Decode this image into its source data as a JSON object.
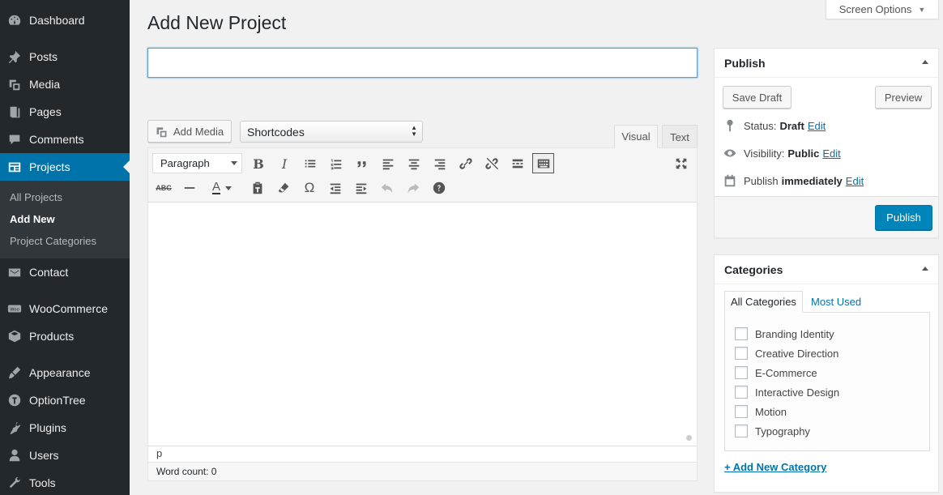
{
  "sidebar": {
    "items": [
      {
        "label": "Dashboard",
        "icon": "dashboard-icon"
      },
      {
        "label": "Posts",
        "icon": "pin-icon"
      },
      {
        "label": "Media",
        "icon": "media-icon"
      },
      {
        "label": "Pages",
        "icon": "page-icon"
      },
      {
        "label": "Comments",
        "icon": "comment-icon"
      },
      {
        "label": "Projects",
        "icon": "portfolio-icon",
        "active": true
      },
      {
        "label": "Contact",
        "icon": "mail-icon"
      },
      {
        "label": "WooCommerce",
        "icon": "woocommerce-icon"
      },
      {
        "label": "Products",
        "icon": "archive-icon"
      },
      {
        "label": "Appearance",
        "icon": "brush-icon"
      },
      {
        "label": "OptionTree",
        "icon": "optiontree-icon"
      },
      {
        "label": "Plugins",
        "icon": "plugin-icon"
      },
      {
        "label": "Users",
        "icon": "user-icon"
      },
      {
        "label": "Tools",
        "icon": "wrench-icon"
      }
    ],
    "submenu": [
      {
        "label": "All Projects"
      },
      {
        "label": "Add New",
        "current": true
      },
      {
        "label": "Project Categories"
      }
    ]
  },
  "screen_options": "Screen Options",
  "page_title": "Add New Project",
  "title_input": {
    "value": "",
    "placeholder": ""
  },
  "editor": {
    "add_media": "Add Media",
    "shortcodes": "Shortcodes",
    "tab_visual": "Visual",
    "tab_text": "Text",
    "format": "Paragraph",
    "path": "p",
    "word_count": "Word count: 0",
    "toolbar_row1": [
      "bold",
      "italic",
      "bullet-list",
      "numbered-list",
      "blockquote",
      "align-left",
      "align-center",
      "align-right",
      "link",
      "unlink",
      "read-more",
      "toolbar-toggle"
    ],
    "toolbar_row2": [
      "strikethrough",
      "horizontal-line",
      "text-color",
      "paste-as-text",
      "clear-formatting",
      "special-character",
      "outdent",
      "indent",
      "undo",
      "redo",
      "help"
    ],
    "accent": "#0073aa"
  },
  "publish": {
    "title": "Publish",
    "save_draft": "Save Draft",
    "preview": "Preview",
    "status_label": "Status:",
    "status_value": "Draft",
    "visibility_label": "Visibility:",
    "visibility_value": "Public",
    "publish_label": "Publish",
    "publish_value": "immediately",
    "edit": "Edit",
    "publish_button": "Publish"
  },
  "categories": {
    "title": "Categories",
    "tab_all": "All Categories",
    "tab_most_used": "Most Used",
    "items": [
      "Branding Identity",
      "Creative Direction",
      "E-Commerce",
      "Interactive Design",
      "Motion",
      "Typography"
    ],
    "add_link": "+ Add New Category"
  }
}
